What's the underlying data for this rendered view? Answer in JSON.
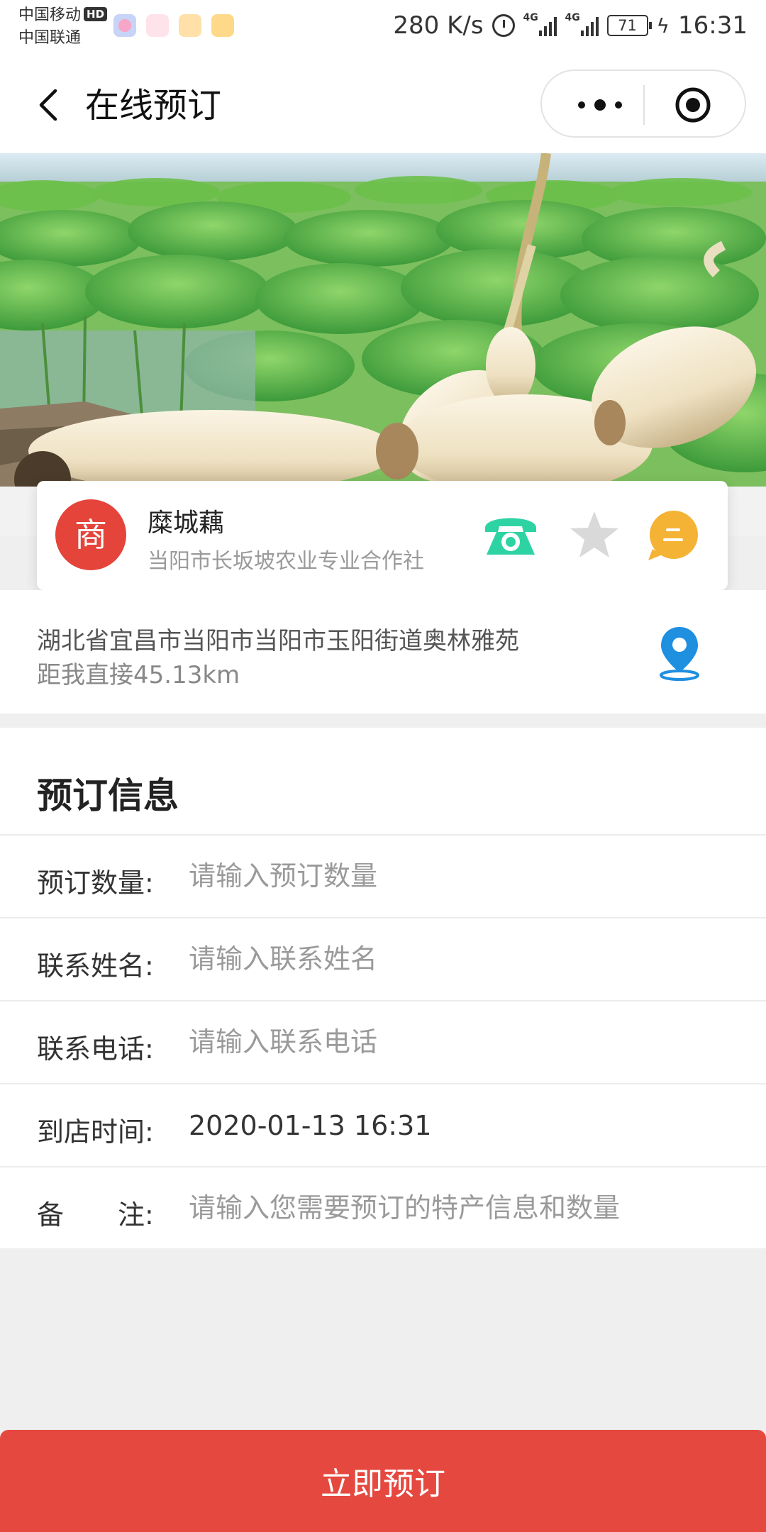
{
  "status_bar": {
    "carrier1": "中国移动",
    "hd": "HD",
    "carrier2": "中国联通",
    "net_speed": "280 K/s",
    "network_tag": "4G",
    "battery": "71",
    "time": "16:31"
  },
  "nav": {
    "title": "在线预订"
  },
  "shop": {
    "avatar_char": "商",
    "name": "糜城藕",
    "subtitle": "当阳市长坂坡农业专业合作社",
    "colors": {
      "avatar": "#e5443a",
      "phone": "#2ed3a4",
      "star": "#d9d9d9",
      "chat": "#f5b335"
    }
  },
  "location": {
    "address": "湖北省宜昌市当阳市当阳市玉阳街道奥林雅苑",
    "distance": "距我直接45.13km",
    "icon_color": "#1f8fe0"
  },
  "form": {
    "heading": "预订信息",
    "fields": [
      {
        "label": "预订数量:",
        "placeholder": "请输入预订数量"
      },
      {
        "label": "联系姓名:",
        "placeholder": "请输入联系姓名"
      },
      {
        "label": "联系电话:",
        "placeholder": "请输入联系电话"
      },
      {
        "label": "到店时间:",
        "value": "2020-01-13 16:31"
      },
      {
        "label": "备　　注:",
        "placeholder": "请输入您需要预订的特产信息和数量"
      }
    ]
  },
  "submit": {
    "label": "立即预订",
    "color": "#e5483f"
  }
}
